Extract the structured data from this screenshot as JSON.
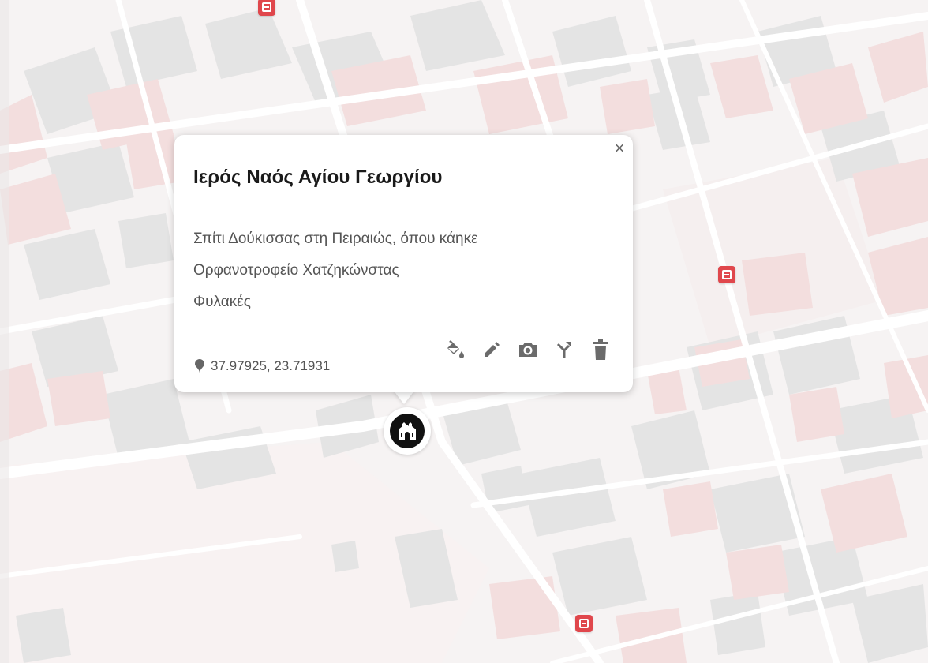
{
  "map": {
    "colors": {
      "background": "#f6f3f3",
      "building_gray": "#e4e4e4",
      "building_pink": "#f3dede",
      "road": "#ffffff",
      "transit": "#e0474c"
    },
    "transit_markers": [
      {
        "icon": "bus-stop-icon"
      },
      {
        "icon": "bus-stop-icon"
      },
      {
        "icon": "bus-stop-icon"
      }
    ],
    "place_marker": {
      "icon": "church-icon"
    }
  },
  "popup": {
    "title": "Ιερός Ναός Αγίου Γεωργίου",
    "description_lines": [
      "Σπίτι Δούκισσας στη Πειραιώς, όπου κάηκε",
      "Ορφανοτροφείο Χατζηκώνστας",
      "Φυλακές"
    ],
    "coordinates": "37.97925, 23.71931",
    "close_label": "×",
    "actions": [
      {
        "icon": "paint-bucket-icon"
      },
      {
        "icon": "edit-pencil-icon"
      },
      {
        "icon": "camera-icon"
      },
      {
        "icon": "directions-icon"
      },
      {
        "icon": "trash-icon"
      }
    ]
  }
}
